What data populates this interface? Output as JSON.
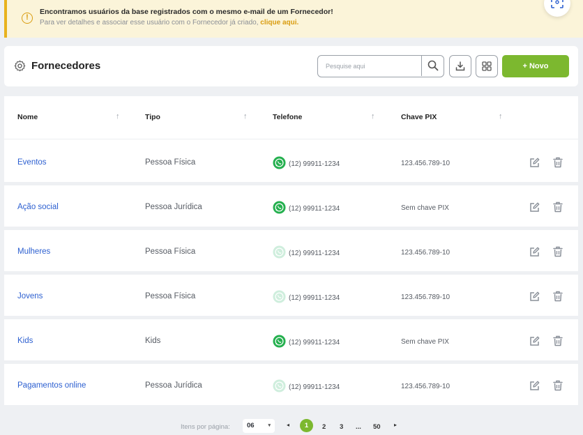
{
  "alert": {
    "title": "Encontramos usuários da base registrados com o mesmo e-mail de um Fornecedor!",
    "text": "Para ver detalhes e associar esse usuário com o Fornecedor já criado,",
    "link": "clique aqui.",
    "icon": "exclamation-icon",
    "icon_glyph": "!"
  },
  "header": {
    "title": "Fornecedores",
    "search_placeholder": "Pesquise aqui",
    "new_button": "+   Novo"
  },
  "table": {
    "columns": [
      "Nome",
      "Tipo",
      "Telefone",
      "Chave PIX"
    ],
    "sort_glyph": "↑",
    "rows": [
      {
        "name": "Eventos",
        "type": "Pessoa Física",
        "phone": "(12) 99911-1234",
        "pix": "123.456.789-10",
        "whatsapp": true
      },
      {
        "name": "Ação social",
        "type": "Pessoa Jurídica",
        "phone": "(12) 99911-1234",
        "pix": "Sem chave PIX",
        "whatsapp": true
      },
      {
        "name": "Mulheres",
        "type": "Pessoa Física",
        "phone": "(12) 99911-1234",
        "pix": "123.456.789-10",
        "whatsapp": false
      },
      {
        "name": "Jovens",
        "type": "Pessoa Física",
        "phone": "(12) 99911-1234",
        "pix": "123.456.789-10",
        "whatsapp": false
      },
      {
        "name": "Kids",
        "type": "Kids",
        "phone": "(12) 99911-1234",
        "pix": "Sem chave PIX",
        "whatsapp": true
      },
      {
        "name": "Pagamentos online",
        "type": "Pessoa Jurídica",
        "phone": "(12) 99911-1234",
        "pix": "123.456.789-10",
        "whatsapp": false
      }
    ]
  },
  "pagination": {
    "label": "Itens por página:",
    "per_page": "06",
    "pages": [
      "1",
      "2",
      "3",
      "...",
      "50"
    ],
    "current": "1",
    "prev": "◂",
    "next": "▸",
    "caret": "▾"
  },
  "colors": {
    "accent": "#7cb82f",
    "link": "#2c5fd0",
    "warning": "#e8b21e",
    "whatsapp": "#25b04f",
    "whatsapp_inactive": "#cfeedd"
  }
}
